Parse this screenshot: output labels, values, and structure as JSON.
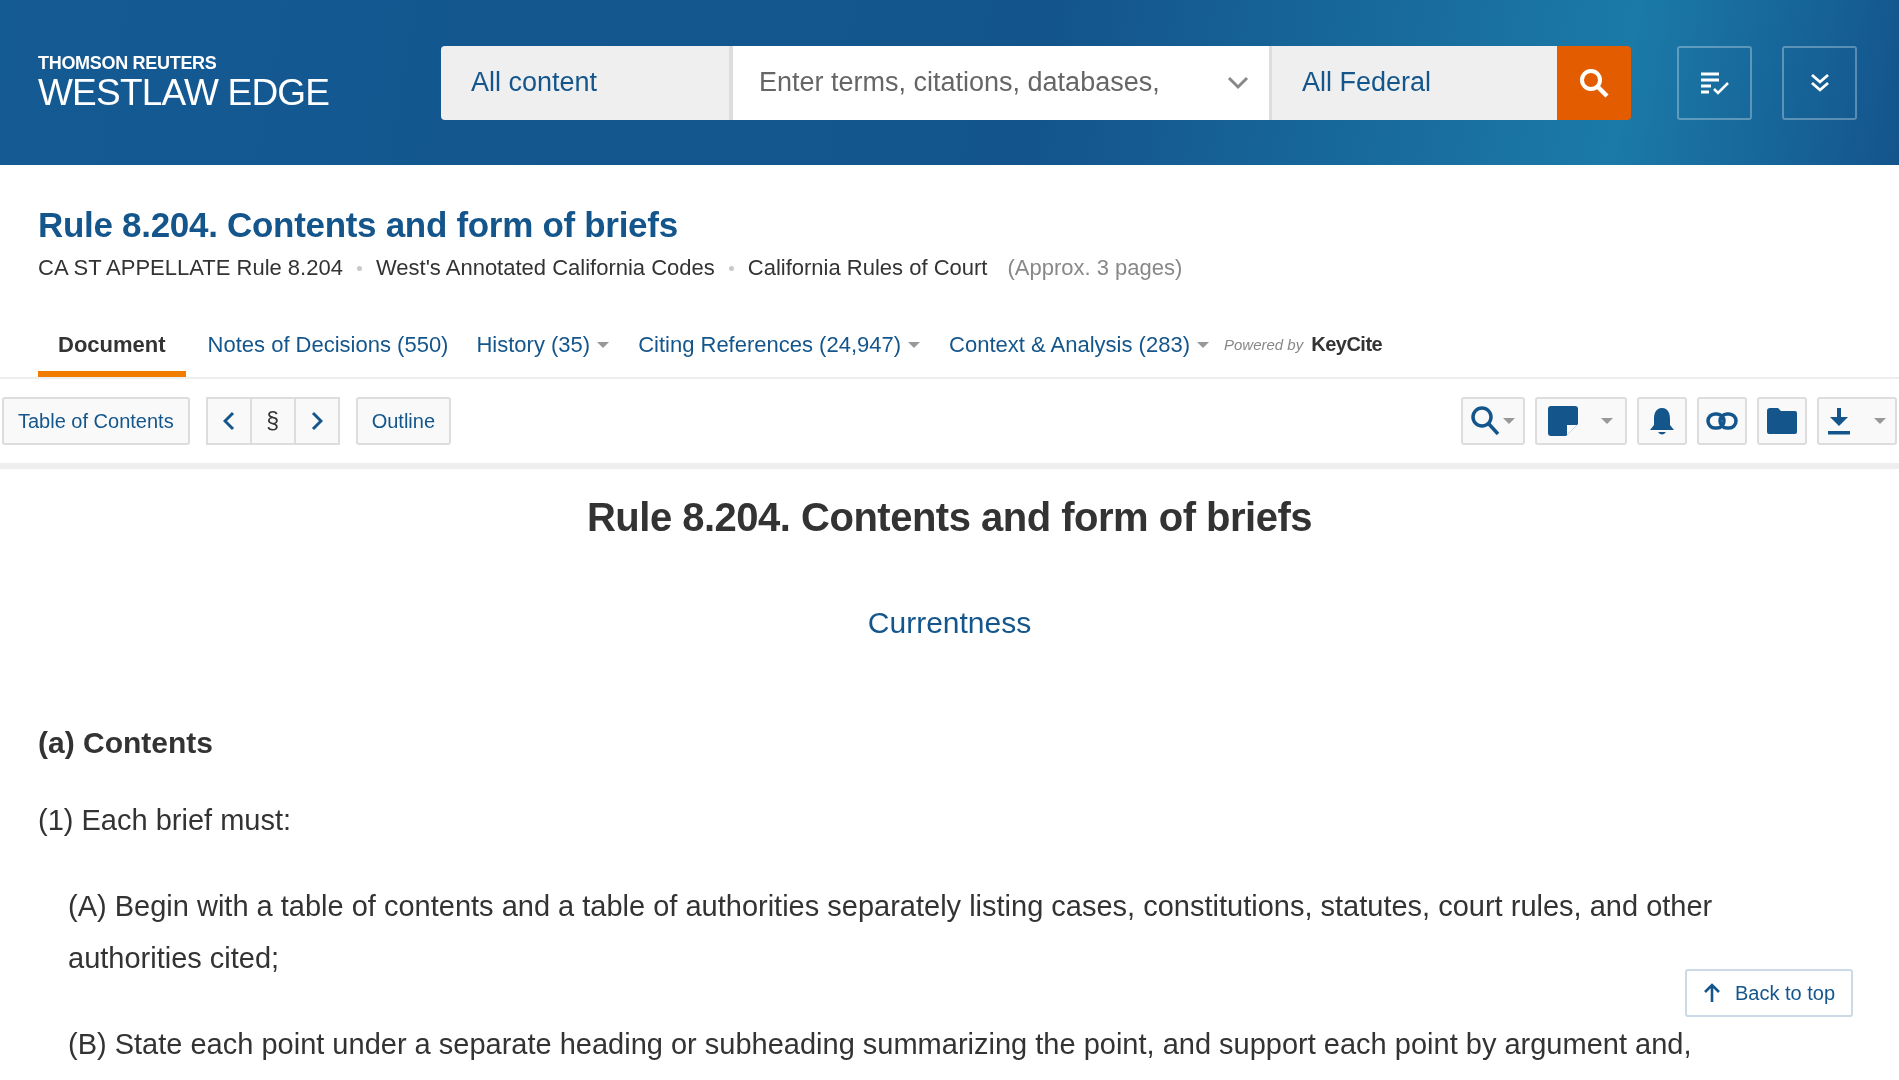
{
  "header": {
    "brand_top": "THOMSON REUTERS",
    "brand_main": "WESTLAW EDGE",
    "content_select": "All content",
    "search": {
      "placeholder": "Enter terms, citations, databases,"
    },
    "jurisdiction": "All Federal"
  },
  "document_header": {
    "title": "Rule 8.204. Contents and form of briefs",
    "meta": [
      "CA ST APPELLATE Rule 8.204",
      "West's Annotated California Codes",
      "California Rules of Court"
    ],
    "pages": "(Approx. 3 pages)"
  },
  "tabs": [
    {
      "label": "Document",
      "selected": true,
      "has_menu": false
    },
    {
      "label": "Notes of Decisions (550)",
      "selected": false,
      "has_menu": false
    },
    {
      "label": "History (35)",
      "selected": false,
      "has_menu": true
    },
    {
      "label": "Citing References (24,947)",
      "selected": false,
      "has_menu": true
    },
    {
      "label": "Context & Analysis (283)",
      "selected": false,
      "has_menu": true
    }
  ],
  "powered_by": {
    "label": "Powered by",
    "brand": "KeyCite"
  },
  "toolbar": {
    "table_of_contents": "Table of Contents",
    "section_symbol": "§",
    "outline": "Outline"
  },
  "document": {
    "heading": "Rule 8.204. Contents and form of briefs",
    "currentness": "Currentness",
    "section_heading": "(a) Contents",
    "paragraphs": [
      {
        "kind": "para",
        "text": "(1) Each brief must:"
      },
      {
        "kind": "subpara",
        "text": "(A) Begin with a table of contents and a table of authorities separately listing cases, constitutions, statutes, court rules, and other authorities cited;"
      },
      {
        "kind": "subpara",
        "text": "(B) State each point under a separate heading or subheading summarizing the point, and support each point by argument and,"
      }
    ]
  },
  "back_to_top": "Back to top"
}
